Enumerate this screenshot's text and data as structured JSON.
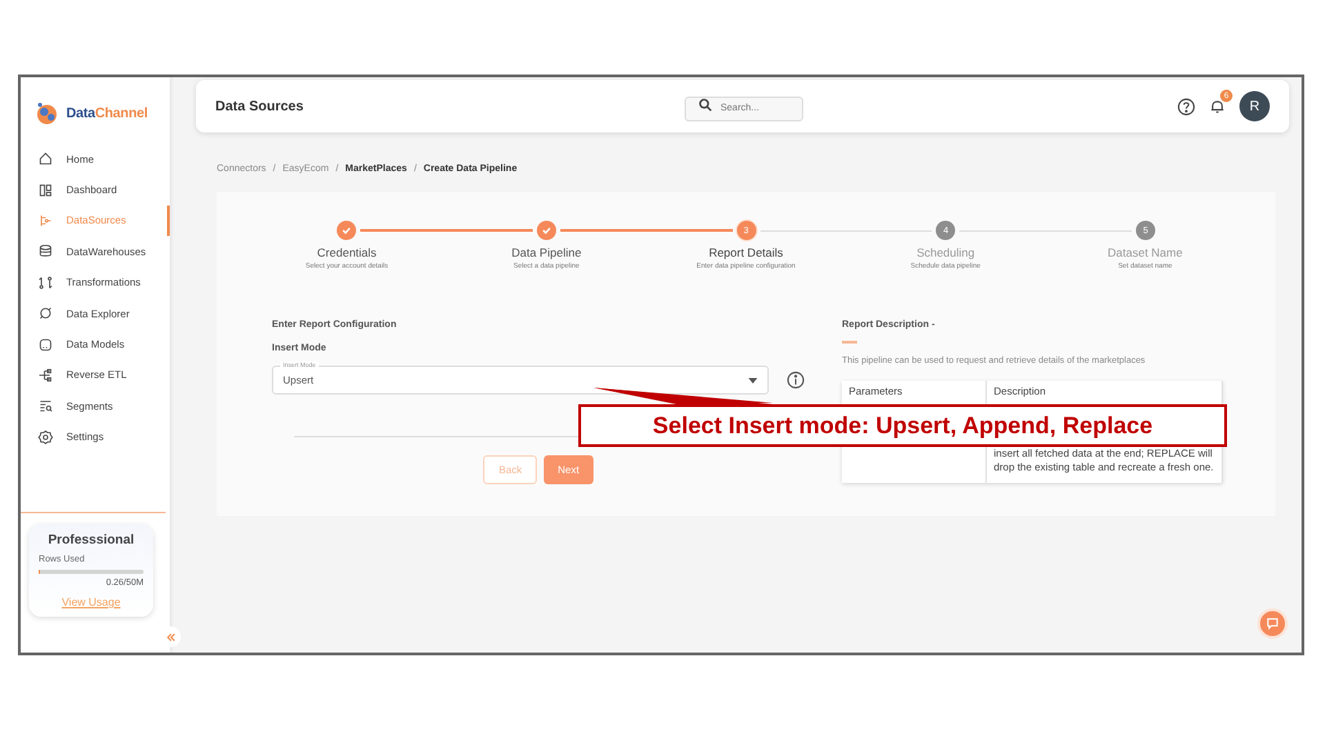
{
  "sidebar": {
    "logo": {
      "first": "Data",
      "second": "Channel"
    },
    "items": [
      {
        "label": "Home",
        "selected": false
      },
      {
        "label": "Dashboard",
        "selected": false
      },
      {
        "label": "DataSources",
        "selected": true
      },
      {
        "label": "DataWarehouses",
        "selected": false
      },
      {
        "label": "Transformations",
        "selected": false
      },
      {
        "label": "Data Explorer",
        "selected": false
      },
      {
        "label": "Data Models",
        "selected": false
      },
      {
        "label": "Reverse ETL",
        "selected": false
      },
      {
        "label": "Segments",
        "selected": false
      },
      {
        "label": "Settings",
        "selected": false
      }
    ],
    "plan": {
      "name": "Professsional",
      "rows_label": "Rows Used",
      "level": 0.005,
      "reading": "0.26/50M",
      "link": "View Usage"
    }
  },
  "header": {
    "title": "Data Sources",
    "search": {
      "placeholder": "Search..."
    },
    "notifications": "6",
    "avatar": "R"
  },
  "breadcrumbs": [
    {
      "label": "Connectors",
      "emphasized": false
    },
    {
      "separator": "/",
      "label": "EasyEcom",
      "emphasized": false
    },
    {
      "separator": "/",
      "label": "MarketPlaces",
      "emphasized": true
    },
    {
      "separator": "/",
      "label": "Create Data Pipeline",
      "emphasized": true
    }
  ],
  "stepper": [
    {
      "completed": true,
      "active": false,
      "title": "Credentials",
      "subtitle": "Select your account details"
    },
    {
      "completed": true,
      "active": false,
      "title": "Data Pipeline",
      "subtitle": "Select a data pipeline"
    },
    {
      "completed": false,
      "active": true,
      "number": "3",
      "title": "Report Details",
      "subtitle": "Enter data pipeline configuration"
    },
    {
      "completed": false,
      "active": false,
      "number": "4",
      "title": "Scheduling",
      "subtitle": "Schedule data pipeline"
    },
    {
      "completed": false,
      "active": false,
      "number": "5",
      "title": "Dataset Name",
      "subtitle": "Set dataset name"
    }
  ],
  "form": {
    "heading": "Enter Report Configuration",
    "label": "Insert Mode",
    "field": {
      "floating_label": "Insert Mode",
      "value": "Upsert"
    },
    "buttons": [
      {
        "label": "Back",
        "kind": "secondary"
      },
      {
        "label": "Next",
        "kind": "primary"
      }
    ]
  },
  "description": {
    "heading": "Report Description -",
    "text": "This pipeline can be used to request and retrieve details of the marketplaces",
    "table": {
      "columns": [
        "Parameters",
        "Description"
      ],
      "rows": [
        [
          "",
          "insert all fetched data at the end; REPLACE will drop the existing table and recreate a fresh one."
        ]
      ]
    }
  },
  "callout": {
    "text": "Select Insert mode: Upsert, Append, Replace"
  }
}
